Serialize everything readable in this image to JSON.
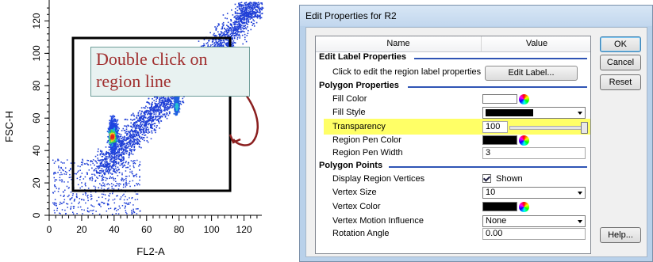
{
  "plot": {
    "y_axis_label": "FSC-H",
    "x_axis_label": "FL2-A",
    "y_ticks": [
      "0",
      "20",
      "40",
      "60",
      "80",
      "100",
      "120"
    ],
    "x_ticks": [
      "0",
      "20",
      "40",
      "60",
      "80",
      "100",
      "120"
    ],
    "callout_lines": [
      "Double click on",
      "region line"
    ]
  },
  "dialog": {
    "title": "Edit Properties for R2",
    "grid": {
      "header_name": "Name",
      "header_value": "Value",
      "categories": {
        "edit_label": "Edit Label Properties",
        "polygon": "Polygon Properties",
        "points": "Polygon Points"
      },
      "props": {
        "click_edit_label": "Click to edit the region label properties",
        "edit_label_button": "Edit Label...",
        "fill_color": "Fill Color",
        "fill_style": "Fill Style",
        "transparency": "Transparency",
        "transparency_value": "100",
        "region_pen_color": "Region Pen Color",
        "region_pen_width": "Region Pen Width",
        "region_pen_width_value": "3",
        "display_vertices": "Display Region Vertices",
        "display_vertices_value": "Shown",
        "vertex_size": "Vertex Size",
        "vertex_size_value": "10",
        "vertex_color": "Vertex Color",
        "vertex_motion": "Vertex Motion Influence",
        "vertex_motion_value": "None",
        "rotation_angle": "Rotation Angle",
        "rotation_angle_value": "0.00"
      }
    },
    "buttons": {
      "ok": "OK",
      "cancel": "Cancel",
      "reset": "Reset",
      "help": "Help..."
    }
  },
  "colors": {
    "highlight": "#ffff66",
    "category_line": "#2f54b5",
    "callout_text": "#a02e2e",
    "arrow": "#8b1f1f"
  }
}
